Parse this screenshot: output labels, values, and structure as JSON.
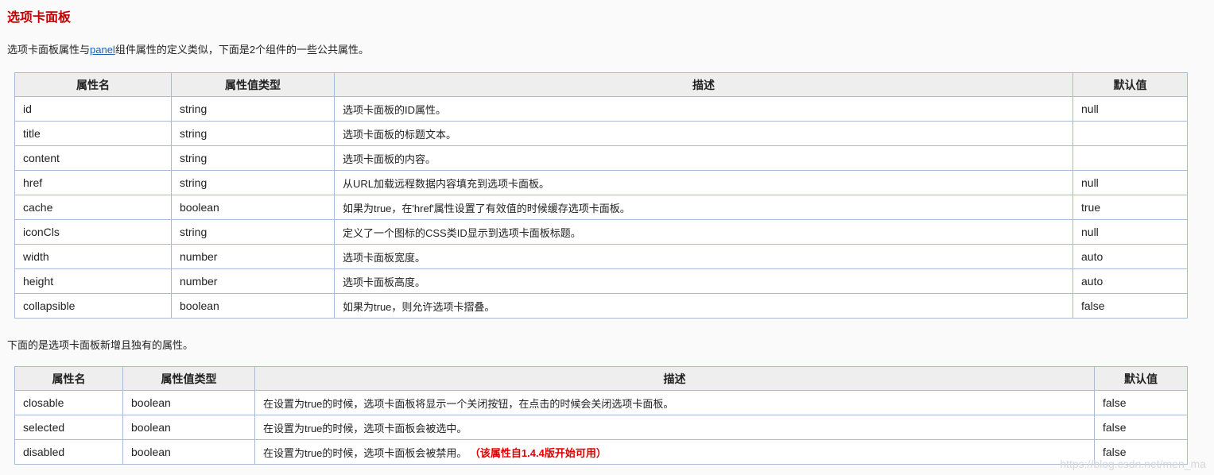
{
  "title": "选项卡面板",
  "intro": {
    "before": "选项卡面板属性与",
    "link": "panel",
    "after": "组件属性的定义类似，下面是2个组件的一些公共属性。"
  },
  "table1": {
    "headers": [
      "属性名",
      "属性值类型",
      "描述",
      "默认值"
    ],
    "rows": [
      {
        "name": "id",
        "type": "string",
        "desc": "选项卡面板的ID属性。",
        "default": "null"
      },
      {
        "name": "title",
        "type": "string",
        "desc": "选项卡面板的标题文本。",
        "default": ""
      },
      {
        "name": "content",
        "type": "string",
        "desc": "选项卡面板的内容。",
        "default": ""
      },
      {
        "name": "href",
        "type": "string",
        "desc": "从URL加载远程数据内容填充到选项卡面板。",
        "default": "null"
      },
      {
        "name": "cache",
        "type": "boolean",
        "desc": "如果为true，在'href'属性设置了有效值的时候缓存选项卡面板。",
        "default": "true"
      },
      {
        "name": "iconCls",
        "type": "string",
        "desc": "定义了一个图标的CSS类ID显示到选项卡面板标题。",
        "default": "null"
      },
      {
        "name": "width",
        "type": "number",
        "desc": "选项卡面板宽度。",
        "default": "auto"
      },
      {
        "name": "height",
        "type": "number",
        "desc": "选项卡面板高度。",
        "default": "auto"
      },
      {
        "name": "collapsible",
        "type": "boolean",
        "desc": "如果为true，则允许选项卡摺叠。",
        "default": "false"
      }
    ]
  },
  "middle_text": "下面的是选项卡面板新增且独有的属性。",
  "table2": {
    "headers": [
      "属性名",
      "属性值类型",
      "描述",
      "默认值"
    ],
    "rows": [
      {
        "name": "closable",
        "type": "boolean",
        "desc": "在设置为true的时候，选项卡面板将显示一个关闭按钮，在点击的时候会关闭选项卡面板。",
        "note": "",
        "default": "false"
      },
      {
        "name": "selected",
        "type": "boolean",
        "desc": "在设置为true的时候，选项卡面板会被选中。",
        "note": "",
        "default": "false"
      },
      {
        "name": "disabled",
        "type": "boolean",
        "desc": "在设置为true的时候，选项卡面板会被禁用。",
        "note": "（该属性自1.4.4版开始可用）",
        "default": "false"
      }
    ]
  },
  "watermark": "https://blog.csdn.net/men_ma"
}
